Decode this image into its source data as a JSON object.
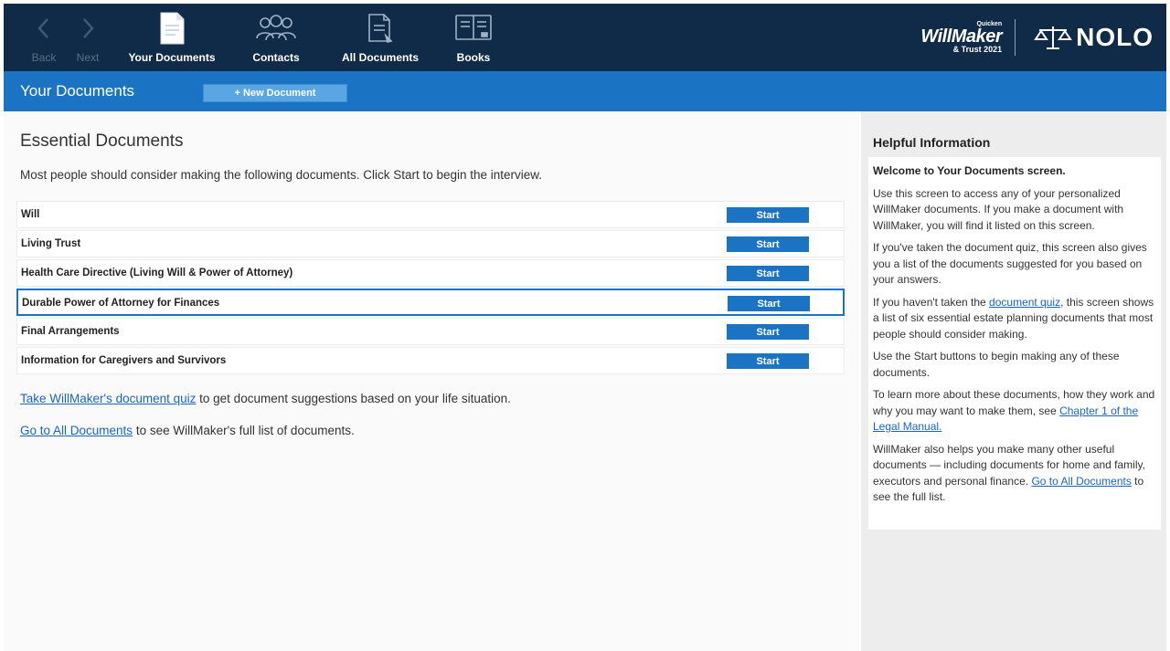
{
  "nav": {
    "back": {
      "label": "Back",
      "icon": "back-arrow-icon"
    },
    "next": {
      "label": "Next",
      "icon": "next-arrow-icon"
    },
    "your_documents": {
      "label": "Your Documents",
      "icon": "document-icon"
    },
    "contacts": {
      "label": "Contacts",
      "icon": "contacts-icon"
    },
    "all_documents": {
      "label": "All Documents",
      "icon": "documents-icon"
    },
    "books": {
      "label": "Books",
      "icon": "book-icon"
    }
  },
  "brand": {
    "product_top": "Quicken",
    "product_main": "WillMaker",
    "product_sub": "& Trust 2021",
    "company": "NOLO",
    "colors": {
      "nav_bg": "#0f2b47",
      "accent": "#1a74c3",
      "link": "#1a64c8"
    }
  },
  "titlebar": {
    "title": "Your Documents",
    "new_document": "+ New Document"
  },
  "main": {
    "section_title": "Essential Documents",
    "intro": "Most people should consider making the following documents. Click Start to begin the interview.",
    "start_label": "Start",
    "documents": [
      {
        "name": "Will",
        "selected": false
      },
      {
        "name": "Living Trust",
        "selected": false
      },
      {
        "name": "Health Care Directive (Living Will & Power of Attorney)",
        "selected": false
      },
      {
        "name": "Durable Power of Attorney for Finances",
        "selected": true
      },
      {
        "name": "Final Arrangements",
        "selected": false
      },
      {
        "name": "Information for Caregivers and Survivors",
        "selected": false
      }
    ],
    "quiz_link": "Take WillMaker's document quiz",
    "quiz_rest": " to get document suggestions based on your life situation.",
    "all_docs_link": "Go to All Documents",
    "all_docs_rest": " to see WillMaker's full list of documents."
  },
  "help": {
    "title": "Helpful Information",
    "welcome": "Welcome to Your Documents screen.",
    "p1": "Use this screen to access any of your personalized WillMaker documents. If you make a document with WillMaker, you will find it listed on this screen.",
    "p2": "If you've taken the document quiz, this screen also gives you a list of the documents suggested for you based on your answers.",
    "p3_before": "If you haven't taken the ",
    "p3_link": "document quiz",
    "p3_after": ", this screen shows a list of six essential estate planning documents that most people should consider making.",
    "p4": "Use the Start buttons to begin making any of these documents.",
    "p5_before": "To learn more about these documents, how they work and why you may want to make them, see ",
    "p5_link": "Chapter 1 of the Legal Manual.",
    "p6_before": "WillMaker also helps you make many other useful documents — including documents for home and family, executors and personal finance. ",
    "p6_link": "Go to All Documents",
    "p6_after": " to see the full list."
  }
}
